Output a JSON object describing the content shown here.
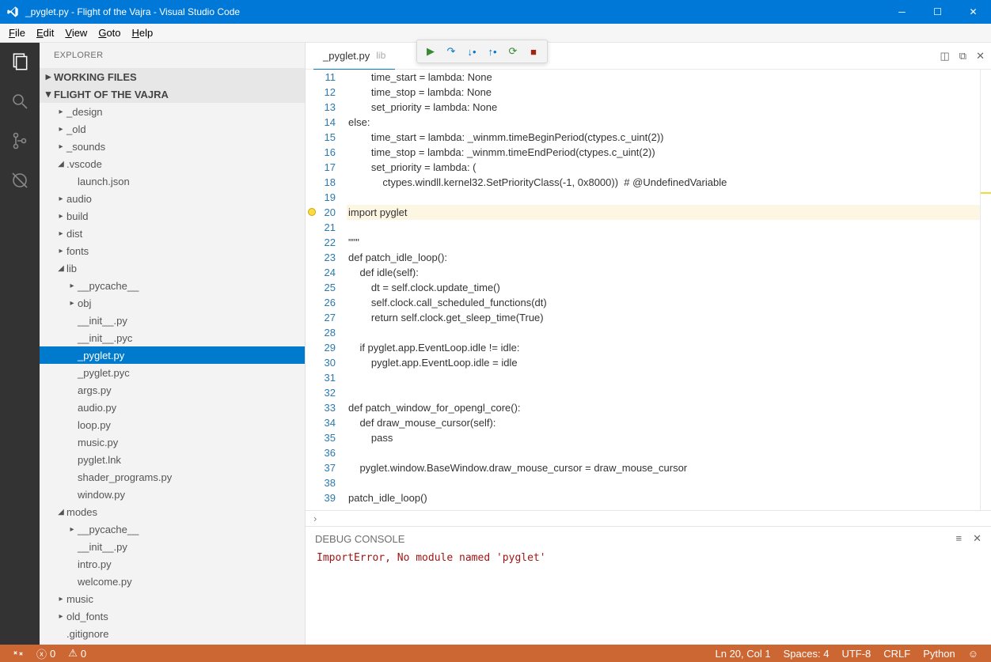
{
  "window": {
    "title": "_pyglet.py - Flight of the Vajra - Visual Studio Code"
  },
  "menu": [
    "File",
    "Edit",
    "View",
    "Goto",
    "Help"
  ],
  "activity": [
    "files",
    "search",
    "git",
    "debug",
    "ext"
  ],
  "sidebar": {
    "title": "EXPLORER",
    "working": "WORKING FILES",
    "project": "FLIGHT OF THE VAJRA",
    "tree": [
      {
        "d": 1,
        "n": "_design",
        "f": true,
        "e": false
      },
      {
        "d": 1,
        "n": "_old",
        "f": true,
        "e": false
      },
      {
        "d": 1,
        "n": "_sounds",
        "f": true,
        "e": false
      },
      {
        "d": 1,
        "n": ".vscode",
        "f": true,
        "e": true
      },
      {
        "d": 2,
        "n": "launch.json"
      },
      {
        "d": 1,
        "n": "audio",
        "f": true,
        "e": false
      },
      {
        "d": 1,
        "n": "build",
        "f": true,
        "e": false
      },
      {
        "d": 1,
        "n": "dist",
        "f": true,
        "e": false
      },
      {
        "d": 1,
        "n": "fonts",
        "f": true,
        "e": false
      },
      {
        "d": 1,
        "n": "lib",
        "f": true,
        "e": true
      },
      {
        "d": 2,
        "n": "__pycache__",
        "f": true,
        "e": false
      },
      {
        "d": 2,
        "n": "obj",
        "f": true,
        "e": false
      },
      {
        "d": 2,
        "n": "__init__.py"
      },
      {
        "d": 2,
        "n": "__init__.pyc"
      },
      {
        "d": 2,
        "n": "_pyglet.py",
        "sel": true
      },
      {
        "d": 2,
        "n": "_pyglet.pyc"
      },
      {
        "d": 2,
        "n": "args.py"
      },
      {
        "d": 2,
        "n": "audio.py"
      },
      {
        "d": 2,
        "n": "loop.py"
      },
      {
        "d": 2,
        "n": "music.py"
      },
      {
        "d": 2,
        "n": "pyglet.lnk"
      },
      {
        "d": 2,
        "n": "shader_programs.py"
      },
      {
        "d": 2,
        "n": "window.py"
      },
      {
        "d": 1,
        "n": "modes",
        "f": true,
        "e": true
      },
      {
        "d": 2,
        "n": "__pycache__",
        "f": true,
        "e": false
      },
      {
        "d": 2,
        "n": "__init__.py"
      },
      {
        "d": 2,
        "n": "intro.py"
      },
      {
        "d": 2,
        "n": "welcome.py"
      },
      {
        "d": 1,
        "n": "music",
        "f": true,
        "e": false
      },
      {
        "d": 1,
        "n": "old_fonts",
        "f": true,
        "e": false
      },
      {
        "d": 1,
        "n": ".gitignore"
      }
    ]
  },
  "tab": {
    "name": "_pyglet.py",
    "folder": "lib"
  },
  "code": {
    "start": 11,
    "highlight": 20,
    "lines": [
      "        time_start = <kw>lambda</kw>: <kw>None</kw>",
      "        time_stop = <kw>lambda</kw>: <kw>None</kw>",
      "        set_priority = <kw>lambda</kw>: <kw>None</kw>",
      "<kw>else</kw>:",
      "        time_start = <kw>lambda</kw>: _winmm.timeBeginPeriod(ctypes.c_uint(<num>2</num>))",
      "        time_stop = <kw>lambda</kw>: _winmm.timeEndPeriod(ctypes.c_uint(<num>2</num>))",
      "        set_priority = <kw>lambda</kw>: (",
      "            ctypes.windll.kernel32.SetPriorityClass(-<num>1</num>, <num>0x8000</num>))  <cm># @UndefinedVariable</cm>",
      "",
      "<kw>import</kw> pyglet",
      "",
      "<str>\"\"\"</str>",
      "<str>def patch_idle_loop():</str>",
      "<str>    def idle(self):</str>",
      "<str>        dt = self.clock.update_time()</str>",
      "<str>        self.clock.call_scheduled_functions(dt)</str>",
      "<str>        return self.clock.get_sleep_time(True)</str>",
      "",
      "<str>    if pyglet.app.EventLoop.idle != idle:</str>",
      "<str>        pyglet.app.EventLoop.idle = idle</str>",
      "",
      "",
      "<str>def patch_window_for_opengl_core():</str>",
      "<str>    def draw_mouse_cursor(self):</str>",
      "<str>        pass</str>",
      "",
      "<str>    pyglet.window.BaseWindow.draw_mouse_cursor = draw_mouse_cursor</str>",
      "",
      "<str>patch_idle_loop()</str>"
    ]
  },
  "breadcrumb": "›",
  "debug": {
    "title": "DEBUG CONSOLE",
    "msg": "ImportError, No module named 'pyglet'"
  },
  "status": {
    "errors": "0",
    "warnings": "0",
    "ln": "Ln 20, Col 1",
    "spaces": "Spaces: 4",
    "enc": "UTF-8",
    "eol": "CRLF",
    "lang": "Python"
  }
}
